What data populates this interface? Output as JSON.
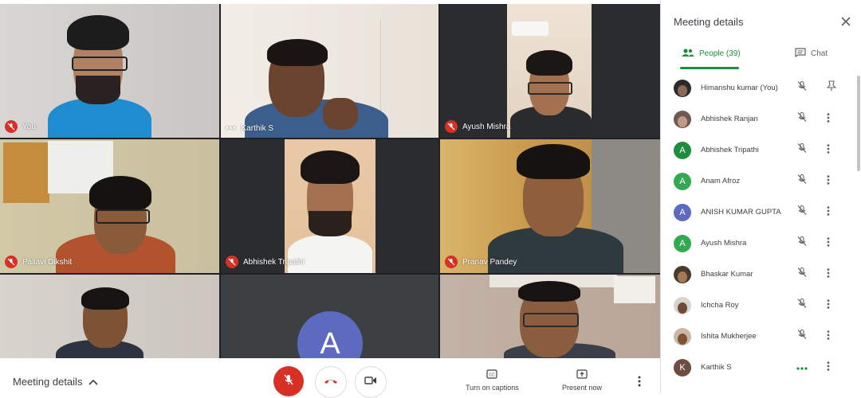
{
  "tiles": [
    {
      "name": "You",
      "indicator": "mic-off"
    },
    {
      "name": "Karthik S",
      "indicator": "more-dots"
    },
    {
      "name": "Ayush Mishra",
      "indicator": "mic-off"
    },
    {
      "name": "Pallavi Dikshit",
      "indicator": "mic-off"
    },
    {
      "name": "Abhishek Tripathi",
      "indicator": "mic-off"
    },
    {
      "name": "Pranav Pandey",
      "indicator": "mic-off"
    },
    {
      "name": "",
      "indicator": "none"
    },
    {
      "name": "",
      "indicator": "none",
      "avatar_letter": "A"
    },
    {
      "name": "",
      "indicator": "none"
    }
  ],
  "bottom_bar": {
    "meeting_details_label": "Meeting details",
    "captions_label": "Turn on captions",
    "present_label": "Present now"
  },
  "panel": {
    "title": "Meeting details",
    "people_tab": "People (39)",
    "chat_tab": "Chat",
    "participants": [
      {
        "name": "Himanshu kumar (You)",
        "avatar": "photo",
        "action": "pin-icon"
      },
      {
        "name": "Abhishek Ranjan",
        "avatar": "photo",
        "action": "more-vert-icon"
      },
      {
        "name": "Abhishek Tripathi",
        "avatar": "A",
        "avatar_color": "#1e8e3e",
        "action": "more-vert-icon"
      },
      {
        "name": "Anam Afroz",
        "avatar": "A",
        "avatar_color": "#34a853",
        "action": "more-vert-icon"
      },
      {
        "name": "ANISH KUMAR GUPTA",
        "avatar": "A",
        "avatar_color": "#5c6bc0",
        "action": "more-vert-icon"
      },
      {
        "name": "Ayush Mishra",
        "avatar": "A",
        "avatar_color": "#34a853",
        "action": "more-vert-icon"
      },
      {
        "name": "Bhaskar Kumar",
        "avatar": "photo",
        "action": "more-vert-icon"
      },
      {
        "name": "Ichcha Roy",
        "avatar": "photo",
        "action": "more-vert-icon"
      },
      {
        "name": "Ishita Mukherjee",
        "avatar": "photo",
        "action": "more-vert-icon"
      },
      {
        "name": "Karthik S",
        "avatar": "K",
        "avatar_color": "#6d4c41",
        "action": "more-vert-icon"
      }
    ]
  },
  "colors": {
    "red": "#d93025",
    "green": "#1e8e3e",
    "accent": "#1a73e8"
  }
}
